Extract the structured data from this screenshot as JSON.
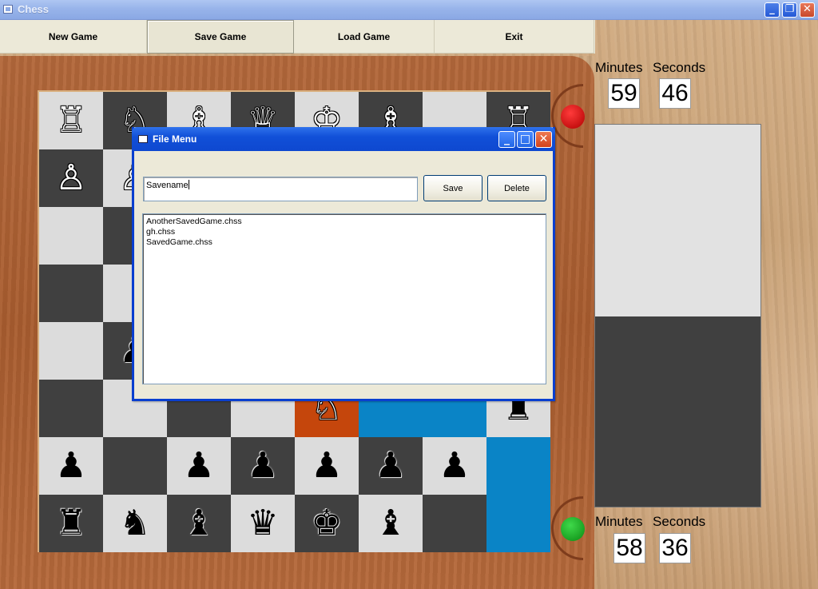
{
  "window": {
    "title": "Chess",
    "min_symbol": "_",
    "max_symbol": "❐",
    "close_symbol": "✕"
  },
  "menu": {
    "new_game": "New Game",
    "save_game": "Save Game",
    "load_game": "Load Game",
    "exit": "Exit"
  },
  "timers": {
    "top": {
      "minutes_label": "Minutes",
      "seconds_label": "Seconds",
      "minutes": "59",
      "seconds": "46"
    },
    "bottom": {
      "minutes_label": "Minutes",
      "seconds_label": "Seconds",
      "minutes": "58",
      "seconds": "36"
    }
  },
  "indicators": {
    "top_color": "#d40000",
    "bottom_color": "#14a81e"
  },
  "board": {
    "rows": [
      [
        [
          "light",
          "♖",
          "w"
        ],
        [
          "dark",
          "♘",
          "w"
        ],
        [
          "light",
          "♗",
          "w"
        ],
        [
          "dark",
          "♕",
          "w"
        ],
        [
          "light",
          "♔",
          "w"
        ],
        [
          "dark",
          "♗",
          "w"
        ],
        [
          "light",
          "",
          ""
        ],
        [
          "dark",
          "♖",
          "w"
        ]
      ],
      [
        [
          "dark",
          "♙",
          "w"
        ],
        [
          "light",
          "♙",
          "w"
        ],
        [
          "dark",
          "",
          ""
        ],
        [
          "light",
          "",
          ""
        ],
        [
          "dark",
          "",
          ""
        ],
        [
          "light",
          "",
          ""
        ],
        [
          "dark",
          "",
          ""
        ],
        [
          "light",
          "",
          ""
        ]
      ],
      [
        [
          "light",
          "",
          ""
        ],
        [
          "dark",
          "",
          ""
        ],
        [
          "light",
          "",
          ""
        ],
        [
          "dark",
          "",
          ""
        ],
        [
          "light",
          "",
          ""
        ],
        [
          "dark",
          "",
          ""
        ],
        [
          "light",
          "",
          ""
        ],
        [
          "dark",
          "",
          ""
        ]
      ],
      [
        [
          "dark",
          "",
          ""
        ],
        [
          "light",
          "",
          ""
        ],
        [
          "dark",
          "",
          ""
        ],
        [
          "light",
          "",
          ""
        ],
        [
          "dark",
          "",
          ""
        ],
        [
          "light",
          "",
          ""
        ],
        [
          "dark",
          "",
          ""
        ],
        [
          "light",
          "",
          ""
        ]
      ],
      [
        [
          "light",
          "",
          ""
        ],
        [
          "dark",
          "♟",
          "b"
        ],
        [
          "light",
          "",
          ""
        ],
        [
          "dark",
          "",
          ""
        ],
        [
          "light",
          "",
          ""
        ],
        [
          "dark",
          "",
          ""
        ],
        [
          "light",
          "",
          ""
        ],
        [
          "dark",
          "",
          ""
        ]
      ],
      [
        [
          "dark",
          "",
          ""
        ],
        [
          "light",
          "",
          ""
        ],
        [
          "dark",
          "",
          ""
        ],
        [
          "light",
          "",
          ""
        ],
        [
          "orange",
          "♘",
          "w"
        ],
        [
          "blue",
          "",
          ""
        ],
        [
          "blue",
          "",
          ""
        ],
        [
          "light",
          "♜",
          "b"
        ]
      ],
      [
        [
          "light",
          "♟",
          "b"
        ],
        [
          "dark",
          "",
          ""
        ],
        [
          "light",
          "♟",
          "b"
        ],
        [
          "dark",
          "♟",
          "b"
        ],
        [
          "light",
          "♟",
          "b"
        ],
        [
          "dark",
          "♟",
          "b"
        ],
        [
          "light",
          "♟",
          "b"
        ],
        [
          "blue",
          "",
          ""
        ]
      ],
      [
        [
          "dark",
          "♜",
          "b"
        ],
        [
          "light",
          "♞",
          "b"
        ],
        [
          "dark",
          "♝",
          "b"
        ],
        [
          "light",
          "♛",
          "b"
        ],
        [
          "dark",
          "♚",
          "b"
        ],
        [
          "light",
          "♝",
          "b"
        ],
        [
          "dark",
          "",
          ""
        ],
        [
          "blue",
          "",
          ""
        ]
      ]
    ]
  },
  "dialog": {
    "title": "File Menu",
    "min_symbol": "_",
    "max_symbol": "□",
    "close_symbol": "✕",
    "name_value": "Savename",
    "save_label": "Save",
    "delete_label": "Delete",
    "files": [
      "AnotherSavedGame.chss",
      "gh.chss",
      "SavedGame.chss"
    ]
  }
}
